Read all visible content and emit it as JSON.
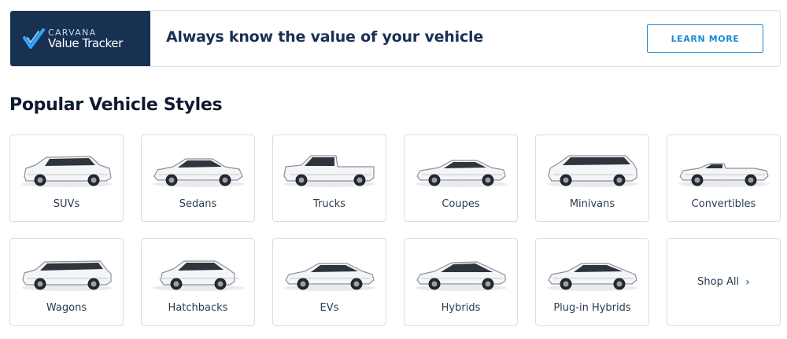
{
  "banner": {
    "logo_brand": "CARVANA",
    "logo_product": "Value Tracker",
    "headline": "Always know the value of your vehicle",
    "cta_label": "LEARN MORE"
  },
  "section": {
    "title": "Popular Vehicle Styles"
  },
  "styles": [
    {
      "label": "SUVs",
      "icon": "suv-car-image"
    },
    {
      "label": "Sedans",
      "icon": "sedan-car-image"
    },
    {
      "label": "Trucks",
      "icon": "truck-image"
    },
    {
      "label": "Coupes",
      "icon": "coupe-car-image"
    },
    {
      "label": "Minivans",
      "icon": "minivan-image"
    },
    {
      "label": "Convertibles",
      "icon": "convertible-car-image"
    },
    {
      "label": "Wagons",
      "icon": "wagon-car-image"
    },
    {
      "label": "Hatchbacks",
      "icon": "hatchback-car-image"
    },
    {
      "label": "EVs",
      "icon": "ev-car-image"
    },
    {
      "label": "Hybrids",
      "icon": "hybrid-car-image"
    },
    {
      "label": "Plug-in Hybrids",
      "icon": "plugin-hybrid-car-image"
    }
  ],
  "shop_all": {
    "label": "Shop All",
    "icon": "chevron-right-icon"
  },
  "colors": {
    "navy": "#183153",
    "accent": "#1a8ad6"
  }
}
